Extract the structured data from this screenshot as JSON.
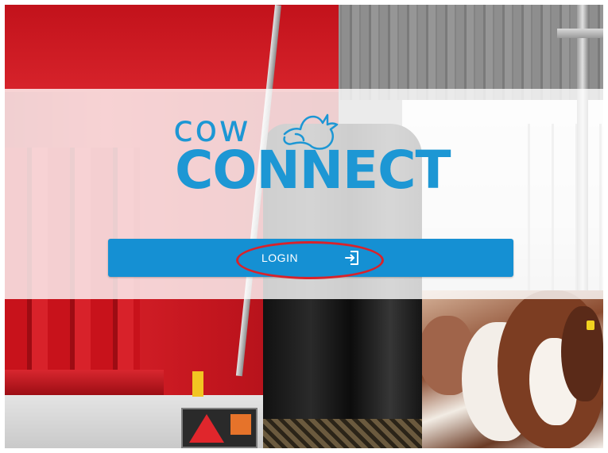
{
  "brand": {
    "name_top": "cow",
    "name_bottom": "CONNECT",
    "logo_icon": "cow-head-icon",
    "color": "#1d97d4"
  },
  "login": {
    "label": "LOGIN",
    "icon": "sign-in-icon",
    "button_color": "#1590d3"
  },
  "annotation": {
    "highlight_color": "#d9222a"
  },
  "background": {
    "description_icon": "photo-background"
  }
}
